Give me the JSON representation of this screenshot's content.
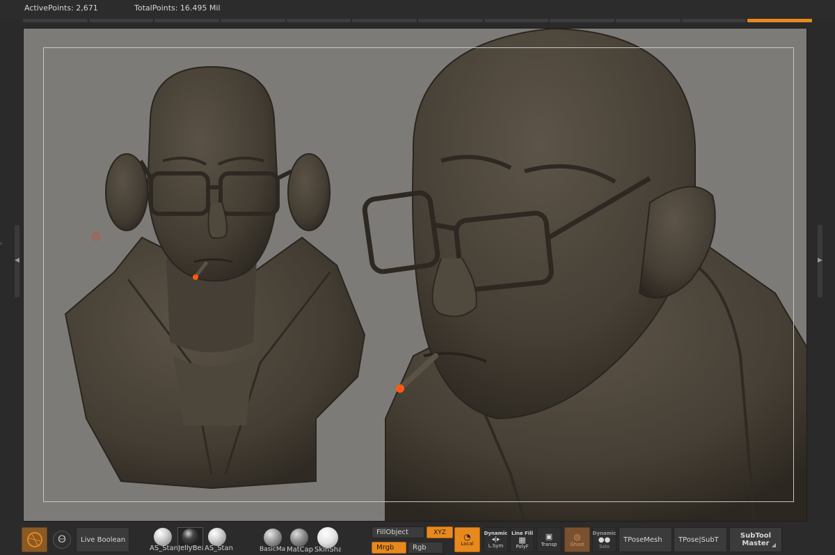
{
  "header": {
    "active_points": "ActivePoints: 2,671",
    "total_points": "TotalPoints: 16.495 Mil"
  },
  "tabs": {
    "count": 12,
    "active_index": 11
  },
  "viewport": {
    "background_color": "#7c7b77",
    "sculpt_color": "#4a4338",
    "ember_color": "#ff5a10"
  },
  "toolbar": {
    "live_boolean": "Live Boolean",
    "materials": [
      {
        "label": "AS_Stan",
        "icon": "white-sphere"
      },
      {
        "label": "JellyBea",
        "icon": "dark-sphere"
      },
      {
        "label": "AS_Stan",
        "icon": "white-sphere"
      },
      {
        "label": "BasicMa",
        "icon": "grey-sphere"
      },
      {
        "label": "MatCap",
        "icon": "grey-sphere"
      },
      {
        "label": "SkinSha",
        "icon": "white-sphere"
      }
    ],
    "fill_object": "FillObject",
    "xyz": "XYZ",
    "mrgb": "Mrgb",
    "rgb": "Rgb",
    "local": "Local",
    "dynamic": "Dynamic",
    "lsym": "L.Sym",
    "line_fill": "Line Fill",
    "polyf": "PolyF",
    "transp": "Transp",
    "ghost": "Ghost",
    "dynamic_solo": "Dynamic",
    "solo": "Solo",
    "tpose_mesh": "TPoseMesh",
    "tpose_subt": "TPose|SubT",
    "subtool_master_1": "SubTool",
    "subtool_master_2": "Master"
  },
  "colors": {
    "accent": "#e8891e",
    "panel": "#2b2b2b",
    "button": "#3b3b3b"
  }
}
